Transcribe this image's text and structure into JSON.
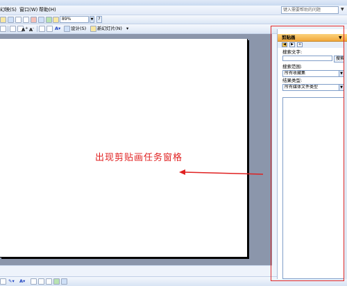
{
  "menu": {
    "items": [
      "幻映(S)",
      "窗口(W)",
      "帮助(H)"
    ],
    "help_search_placeholder": "键入需要帮助的问题"
  },
  "toolbar": {
    "zoom": "89%",
    "design_label": "设计(S)",
    "new_slide_label": "新幻灯片(N)"
  },
  "task_pane": {
    "title": "剪贴画",
    "search_text_label": "搜索文字:",
    "search_input_value": "",
    "search_button": "搜索",
    "search_range_label": "搜索范围:",
    "search_range_value": "所有收藏集",
    "result_type_label": "结果类型:",
    "result_type_value": "所有媒体文件类型"
  },
  "annotation": {
    "text": "出现剪贴画任务窗格",
    "color": "#e02020"
  },
  "colors": {
    "pane_header": "#f2a93c",
    "workspace": "#8b96ab",
    "highlight": "#e02828"
  }
}
